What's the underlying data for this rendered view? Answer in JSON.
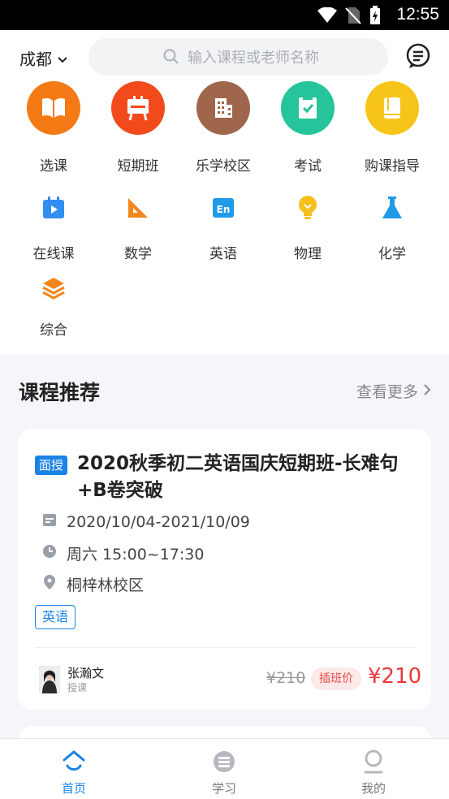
{
  "status_bar": {
    "time": "12:55"
  },
  "header": {
    "city": "成都",
    "search_placeholder": "输入课程或老师名称"
  },
  "categories_primary": [
    {
      "label": "选课",
      "icon": "book-icon",
      "color": "#f47a16"
    },
    {
      "label": "短期班",
      "icon": "easel-icon",
      "color": "#f34a1c"
    },
    {
      "label": "乐学校区",
      "icon": "building-icon",
      "color": "#a0664b"
    },
    {
      "label": "考试",
      "icon": "exam-check-icon",
      "color": "#26c49a"
    },
    {
      "label": "购课指导",
      "icon": "guide-book-icon",
      "color": "#f7c419"
    }
  ],
  "categories_secondary": [
    {
      "label": "在线课",
      "icon": "calendar-play-icon"
    },
    {
      "label": "数学",
      "icon": "triangle-ruler-icon"
    },
    {
      "label": "英语",
      "icon": "en-icon"
    },
    {
      "label": "物理",
      "icon": "bulb-icon"
    },
    {
      "label": "化学",
      "icon": "flask-icon"
    },
    {
      "label": "综合",
      "icon": "layers-icon"
    }
  ],
  "section": {
    "title": "课程推荐",
    "more": "查看更多"
  },
  "course": {
    "badge": "面授",
    "title": "2020秋季初二英语国庆短期班-长难句+B卷突破",
    "date_range": "2020/10/04-2021/10/09",
    "schedule": "周六  15:00~17:30",
    "location": "桐梓林校区",
    "tag": "英语",
    "teacher_name": "张瀚文",
    "teacher_role": "授课",
    "original_price": "¥210",
    "price_label": "插班价",
    "price": "¥210"
  },
  "tabbar": {
    "home": "首页",
    "study": "学习",
    "mine": "我的"
  }
}
